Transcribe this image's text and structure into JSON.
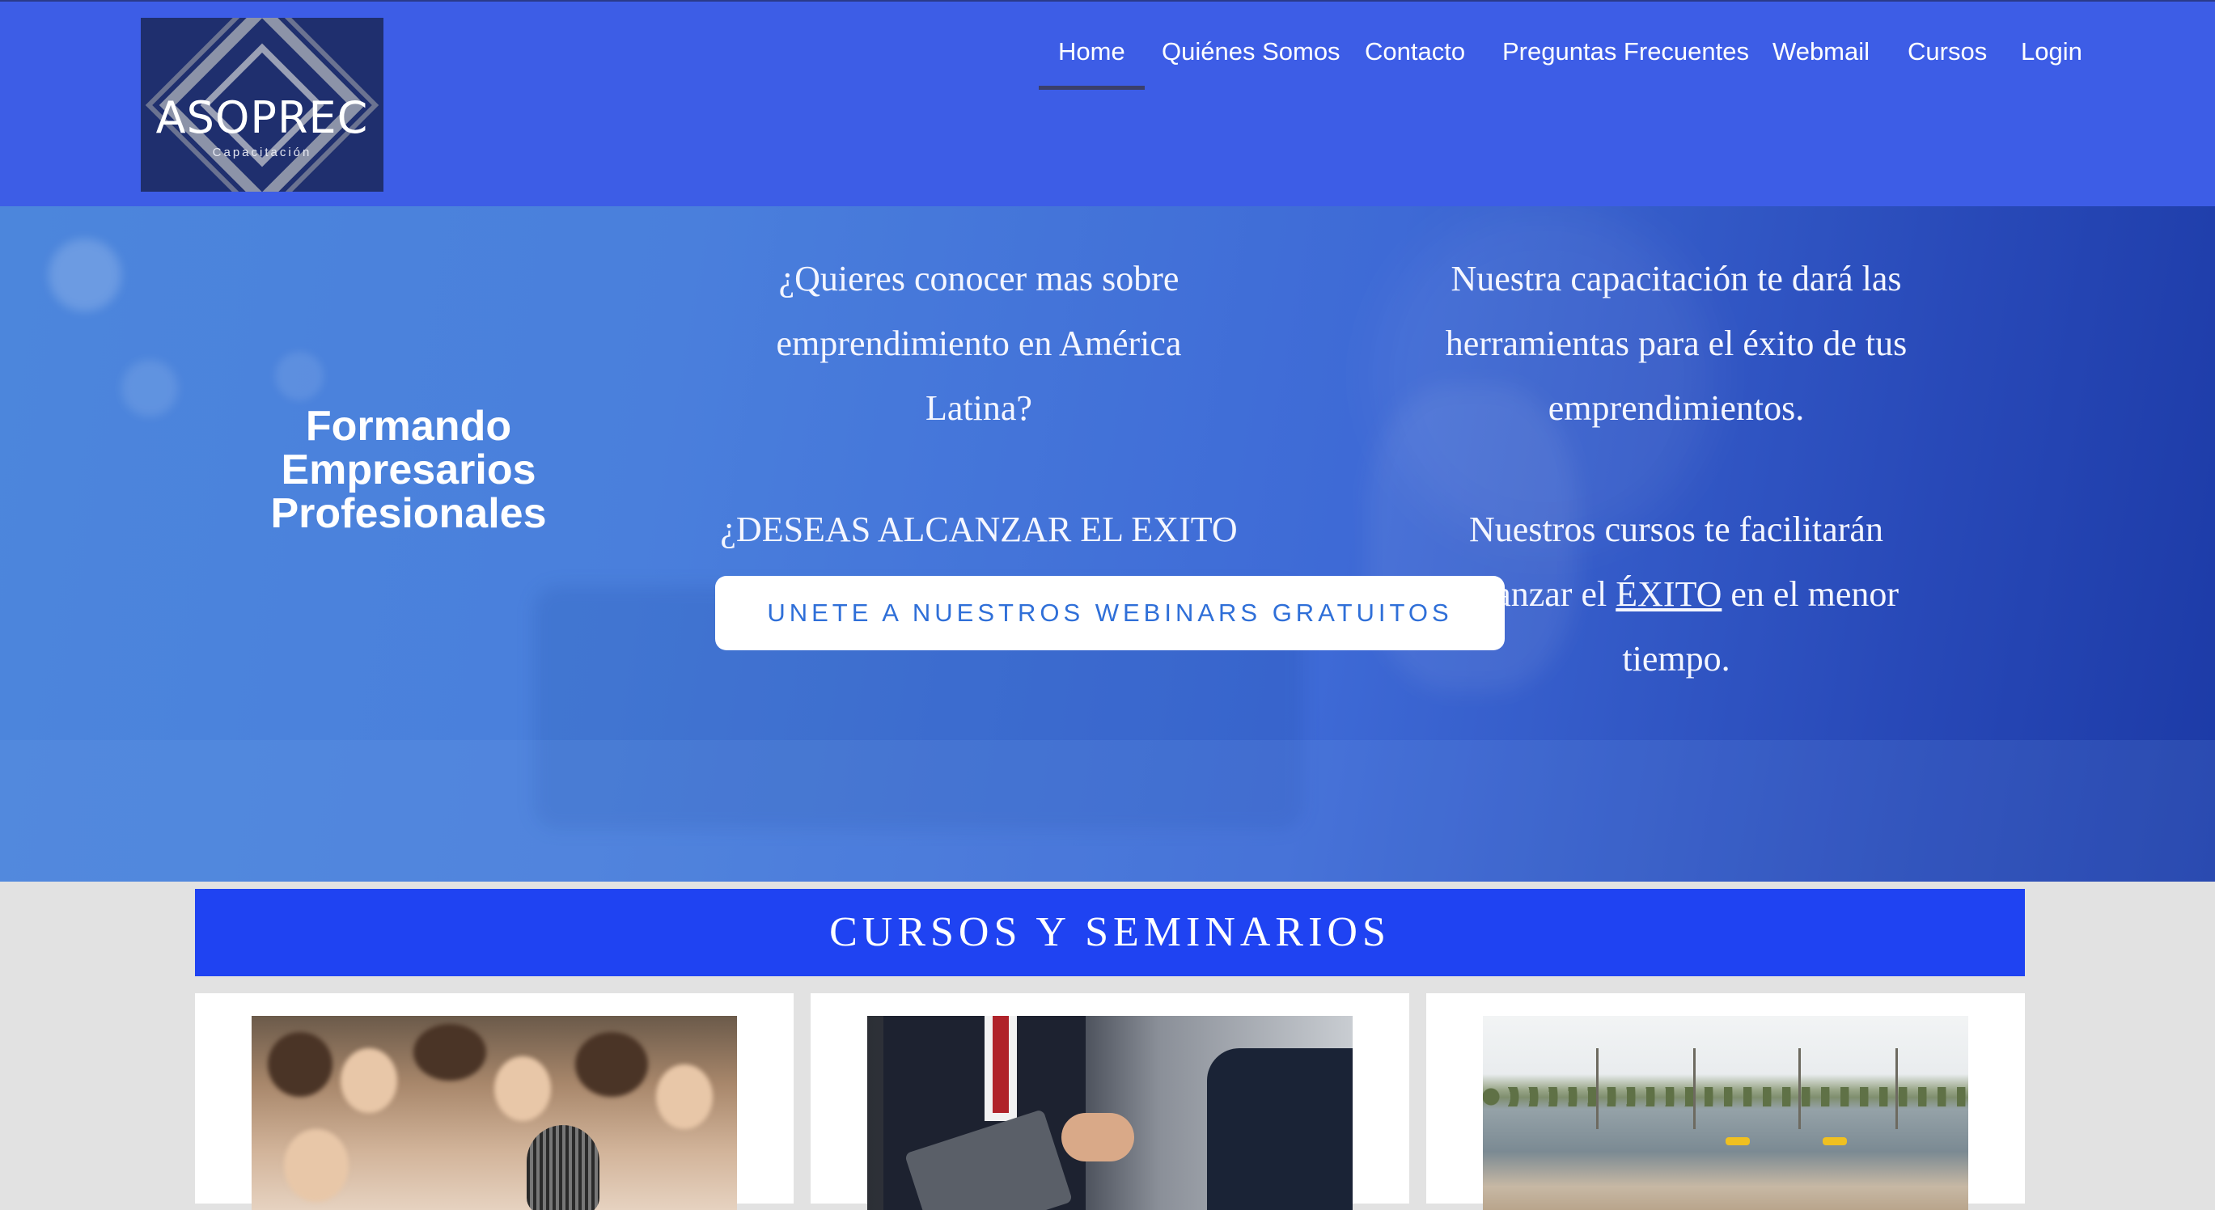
{
  "header": {
    "logo": {
      "title": "ASOPREC",
      "subtitle": "Capacitación"
    },
    "nav": [
      {
        "label": "Home",
        "active": true
      },
      {
        "label": "Quiénes Somos",
        "active": false
      },
      {
        "label": "Contacto",
        "active": false
      },
      {
        "label": "Preguntas Frecuentes",
        "active": false
      },
      {
        "label": "Webmail",
        "active": false
      },
      {
        "label": "Cursos",
        "active": false
      },
      {
        "label": "Login",
        "active": false
      }
    ],
    "background_color": "#3d5de6"
  },
  "hero": {
    "headline": "Formando Empresarios Profesionales",
    "col1": {
      "question1": "¿Quieres conocer mas sobre emprendimiento en América Latina?",
      "question2": "¿DESEAS ALCANZAR EL EXITO PERSONAL Y EMPRESARIAL?"
    },
    "col2": {
      "text1": "Nuestra capacitación te dará las herramientas para el éxito de tus emprendimientos.",
      "text2_before": "Nuestros cursos te facilitarán alcanzar el ",
      "text2_emphasis": "ÉXITO",
      "text2_after": " en el menor tiempo."
    },
    "cta_label": "UNETE A NUESTROS WEBINARS GRATUITOS"
  },
  "courses": {
    "section_title": "CURSOS Y SEMINARIOS",
    "accent_color": "#1f43f2",
    "cards": [
      {
        "image": "audience-microphone-photo"
      },
      {
        "image": "business-tablet-photo"
      },
      {
        "image": "pond-landscape-photo"
      }
    ]
  }
}
